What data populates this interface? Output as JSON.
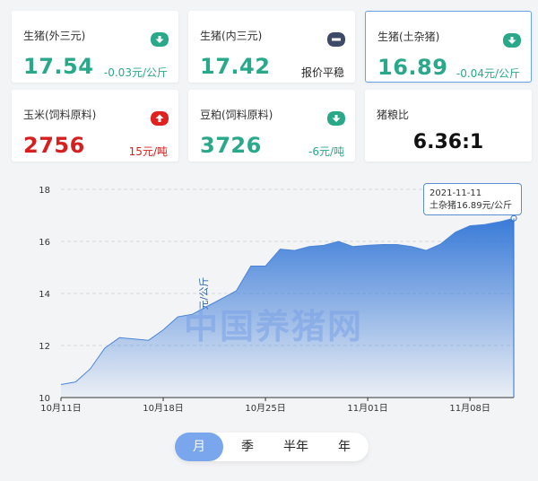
{
  "cards": [
    {
      "name": "生猪(外三元)",
      "value": "17.54",
      "change": "-0.03元/公斤",
      "trend": "down",
      "value_color": "#2aa88a",
      "change_color": "#2aa88a",
      "icon": "arrow-down-icon",
      "icon_color": "#2aa88a"
    },
    {
      "name": "生猪(内三元)",
      "value": "17.42",
      "change": "报价平稳",
      "trend": "flat",
      "value_color": "#2aa88a",
      "change_color": "#222222",
      "icon": "minus-icon",
      "icon_color": "#3f4a68"
    },
    {
      "name": "生猪(土杂猪)",
      "value": "16.89",
      "change": "-0.04元/公斤",
      "trend": "down",
      "value_color": "#2aa88a",
      "change_color": "#2aa88a",
      "icon": "arrow-down-icon",
      "icon_color": "#2aa88a"
    },
    {
      "name": "玉米(饲料原料)",
      "value": "2756",
      "change": "15元/吨",
      "trend": "up",
      "value_color": "#d6201f",
      "change_color": "#d6201f",
      "icon": "arrow-up-icon",
      "icon_color": "#e1211f"
    },
    {
      "name": "豆粕(饲料原料)",
      "value": "3726",
      "change": "-6元/吨",
      "trend": "down",
      "value_color": "#2aa88a",
      "change_color": "#2aa88a",
      "icon": "arrow-down-icon",
      "icon_color": "#2aa88a"
    },
    {
      "name": "猪粮比",
      "value": "6.36:1"
    }
  ],
  "chart_data": {
    "type": "area",
    "ylabel": "元/公斤",
    "ylim": [
      10,
      18
    ],
    "yticks": [
      "10",
      "12",
      "14",
      "16",
      "18"
    ],
    "xticks": [
      "10月11日",
      "10月18日",
      "10月25日",
      "11月01日",
      "11月08日"
    ],
    "series": [
      {
        "name": "土杂猪",
        "x": [
          "10-11",
          "10-12",
          "10-13",
          "10-14",
          "10-15",
          "10-16",
          "10-17",
          "10-18",
          "10-19",
          "10-20",
          "10-21",
          "10-22",
          "10-23",
          "10-24",
          "10-25",
          "10-26",
          "10-27",
          "10-28",
          "10-29",
          "10-30",
          "10-31",
          "11-01",
          "11-02",
          "11-03",
          "11-04",
          "11-05",
          "11-06",
          "11-07",
          "11-08",
          "11-09",
          "11-10",
          "11-11"
        ],
        "values": [
          10.5,
          10.6,
          11.1,
          11.9,
          12.3,
          12.25,
          12.2,
          12.6,
          13.1,
          13.2,
          13.5,
          13.8,
          14.1,
          15.05,
          15.05,
          15.7,
          15.65,
          15.8,
          15.85,
          16.0,
          15.8,
          15.85,
          15.88,
          15.88,
          15.8,
          15.65,
          15.9,
          16.35,
          16.6,
          16.65,
          16.75,
          16.89
        ]
      }
    ],
    "watermark": "中国养猪网",
    "tooltip_date": "2021-11-11",
    "tooltip_text": "土杂猪16.89元/公斤"
  },
  "periods": [
    "月",
    "季",
    "半年",
    "年"
  ],
  "active_period": "月"
}
